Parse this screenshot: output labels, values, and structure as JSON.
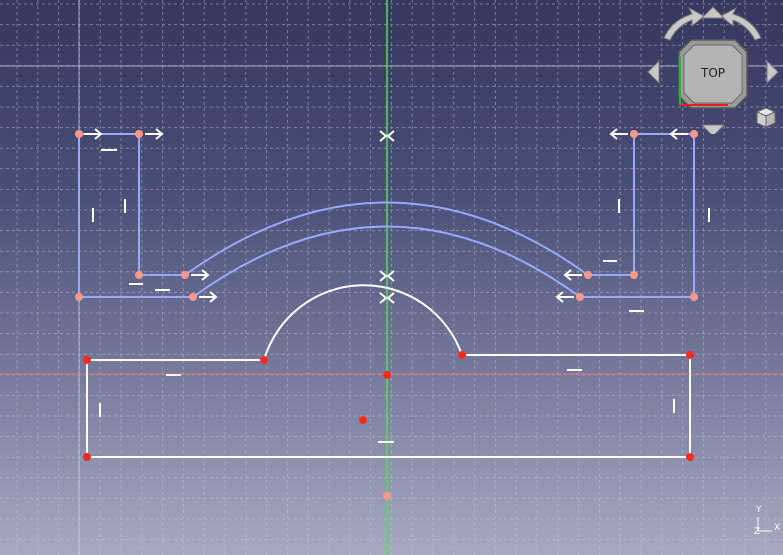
{
  "navcube": {
    "face_label": "TOP",
    "icons": [
      "rotate-left-icon",
      "rotate-right-icon",
      "arrow-up-icon",
      "arrow-down-icon",
      "arrow-left-icon",
      "arrow-right-icon",
      "home-cube-icon"
    ]
  },
  "axis_indicator": {
    "x": "X",
    "y": "Y",
    "z": "Z"
  },
  "colors": {
    "grid": "#c8cadc",
    "vertical_axis": "#55dd55",
    "horizontal_axis": "#d97070",
    "construction": "#9aa8ff",
    "geometry": "#ffffff",
    "point_fixed": "#ff2a1a",
    "point_construction": "#ff9a8a",
    "cube_face": "#a8a8a8",
    "cube_edge": "#707070"
  },
  "constraint_icons": [
    "horizontal-constraint-icon",
    "vertical-constraint-icon",
    "symmetric-constraint-icon",
    "tangent-arrow-icon"
  ]
}
